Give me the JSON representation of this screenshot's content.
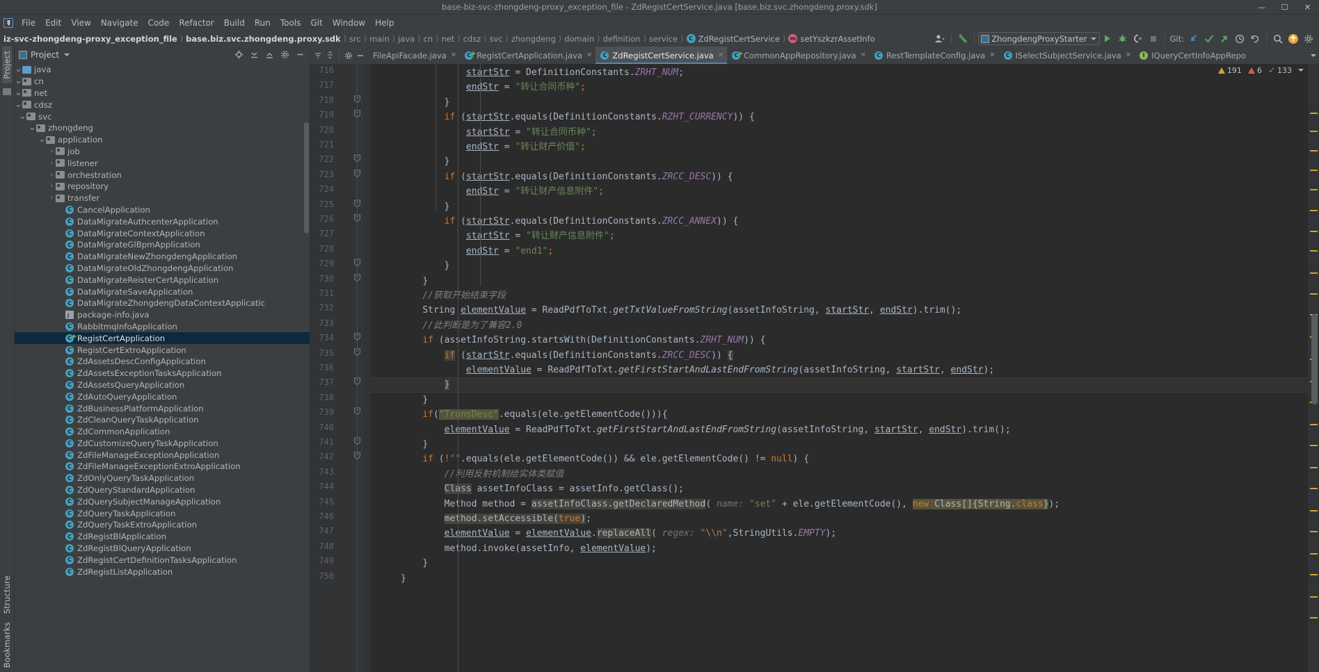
{
  "window": {
    "title": "base-biz-svc-zhongdeng-proxy_exception_file - ZdRegistCertService.java [base.biz.svc.zhongdeng.proxy.sdk]",
    "minimize": "—",
    "maximize": "☐",
    "close": "✕"
  },
  "menubar": {
    "logo": "IJ",
    "items": [
      "File",
      "Edit",
      "View",
      "Navigate",
      "Code",
      "Refactor",
      "Build",
      "Run",
      "Tools",
      "Git",
      "Window",
      "Help"
    ]
  },
  "breadcrumbs": {
    "project": "iz-svc-zhongdeng-proxy_exception_file",
    "module": "base.biz.svc.zhongdeng.proxy.sdk",
    "path": [
      "src",
      "main",
      "java",
      "cn",
      "net",
      "cdsz",
      "svc",
      "zhongdeng",
      "domain",
      "definition",
      "service"
    ],
    "class": "ZdRegistCertService",
    "class_icon": "C",
    "method": "setYszkzrAssetInfo",
    "method_icon": "m"
  },
  "toolbar": {
    "profile_icon": "person-icon",
    "back_icon": "back-arrow-icon",
    "run_config": "ZhongdengProxyStarter",
    "run_icon": "run-icon",
    "debug_icon": "debug-icon",
    "coverage_icon": "run-coverage-icon",
    "stop_icon": "stop-icon",
    "git_label": "Git:",
    "update_icon": "update-project-icon",
    "commit_icon": "commit-icon",
    "push_icon": "push-icon",
    "history_icon": "history-icon",
    "rollback_icon": "rollback-icon",
    "search_icon": "search-everywhere-icon",
    "notification_icon": "notification-icon",
    "settings_icon": "settings-icon"
  },
  "left_strip": {
    "project_label": "Project",
    "structure_label": "Structure",
    "bookmarks_label": "Bookmarks"
  },
  "project_panel": {
    "title": "Project",
    "locate_icon": "locate-file-icon",
    "expand_icon": "expand-all-icon",
    "collapse_icon": "collapse-all-icon",
    "settings_icon": "gear-icon",
    "hide_icon": "hide-panel-icon",
    "tree": [
      {
        "label": "java",
        "indent": 5,
        "arrow": "v",
        "icon": "folder-blue"
      },
      {
        "label": "cn",
        "indent": 6,
        "arrow": "v",
        "icon": "folder-pkg"
      },
      {
        "label": "net",
        "indent": 7,
        "arrow": "v",
        "icon": "folder-pkg"
      },
      {
        "label": "cdsz",
        "indent": 8,
        "arrow": "v",
        "icon": "folder-pkg"
      },
      {
        "label": "svc",
        "indent": 9,
        "arrow": "v",
        "icon": "folder-pkg"
      },
      {
        "label": "zhongdeng",
        "indent": 10,
        "arrow": "v",
        "icon": "folder-pkg"
      },
      {
        "label": "application",
        "indent": 11,
        "arrow": "v",
        "icon": "folder-pkg"
      },
      {
        "label": "job",
        "indent": 12,
        "arrow": ">",
        "icon": "folder-pkg"
      },
      {
        "label": "listener",
        "indent": 12,
        "arrow": ">",
        "icon": "folder-pkg"
      },
      {
        "label": "orchestration",
        "indent": 12,
        "arrow": ">",
        "icon": "folder-pkg"
      },
      {
        "label": "repository",
        "indent": 12,
        "arrow": ">",
        "icon": "folder-pkg"
      },
      {
        "label": "transfer",
        "indent": 12,
        "arrow": ">",
        "icon": "folder-pkg"
      },
      {
        "label": "CancelApplication",
        "indent": 13,
        "arrow": "",
        "icon": "class"
      },
      {
        "label": "DataMigrateAuthcenterApplication",
        "indent": 13,
        "arrow": "",
        "icon": "class"
      },
      {
        "label": "DataMigrateContextApplication",
        "indent": 13,
        "arrow": "",
        "icon": "class"
      },
      {
        "label": "DataMigrateGlBpmApplication",
        "indent": 13,
        "arrow": "",
        "icon": "class"
      },
      {
        "label": "DataMigrateNewZhongdengApplication",
        "indent": 13,
        "arrow": "",
        "icon": "class"
      },
      {
        "label": "DataMigrateOldZhongdengApplication",
        "indent": 13,
        "arrow": "",
        "icon": "class"
      },
      {
        "label": "DataMigrateReisterCertApplication",
        "indent": 13,
        "arrow": "",
        "icon": "class"
      },
      {
        "label": "DataMigrateSaveApplication",
        "indent": 13,
        "arrow": "",
        "icon": "class"
      },
      {
        "label": "DataMigrateZhongdengDataContextApplicatic",
        "indent": 13,
        "arrow": "",
        "icon": "class"
      },
      {
        "label": "package-info.java",
        "indent": 13,
        "arrow": "",
        "icon": "package-info"
      },
      {
        "label": "RabbitmqInfoApplication",
        "indent": 13,
        "arrow": "",
        "icon": "class"
      },
      {
        "label": "RegistCertApplication",
        "indent": 13,
        "arrow": "",
        "icon": "class-run",
        "selected": true
      },
      {
        "label": "RegistCertExtroApplication",
        "indent": 13,
        "arrow": "",
        "icon": "class"
      },
      {
        "label": "ZdAssetsDescConfigApplication",
        "indent": 13,
        "arrow": "",
        "icon": "class"
      },
      {
        "label": "ZdAssetsExceptionTasksApplication",
        "indent": 13,
        "arrow": "",
        "icon": "class"
      },
      {
        "label": "ZdAssetsQueryApplication",
        "indent": 13,
        "arrow": "",
        "icon": "class"
      },
      {
        "label": "ZdAutoQueryApplication",
        "indent": 13,
        "arrow": "",
        "icon": "class"
      },
      {
        "label": "ZdBusinessPlatformApplication",
        "indent": 13,
        "arrow": "",
        "icon": "class"
      },
      {
        "label": "ZdCleanQueryTaskApplication",
        "indent": 13,
        "arrow": "",
        "icon": "class"
      },
      {
        "label": "ZdCommonApplication",
        "indent": 13,
        "arrow": "",
        "icon": "class"
      },
      {
        "label": "ZdCustomizeQueryTaskApplication",
        "indent": 13,
        "arrow": "",
        "icon": "class"
      },
      {
        "label": "ZdFileManageExceptionApplication",
        "indent": 13,
        "arrow": "",
        "icon": "class"
      },
      {
        "label": "ZdFileManageExceptionExtroApplication",
        "indent": 13,
        "arrow": "",
        "icon": "class"
      },
      {
        "label": "ZdOnlyQueryTaskApplication",
        "indent": 13,
        "arrow": "",
        "icon": "class"
      },
      {
        "label": "ZdQueryStandardApplication",
        "indent": 13,
        "arrow": "",
        "icon": "class"
      },
      {
        "label": "ZdQuerySubjectManageApplication",
        "indent": 13,
        "arrow": "",
        "icon": "class"
      },
      {
        "label": "ZdQueryTaskApplication",
        "indent": 13,
        "arrow": "",
        "icon": "class"
      },
      {
        "label": "ZdQueryTaskExtroApplication",
        "indent": 13,
        "arrow": "",
        "icon": "class"
      },
      {
        "label": "ZdRegistBlApplication",
        "indent": 13,
        "arrow": "",
        "icon": "class"
      },
      {
        "label": "ZdRegistBlQueryApplication",
        "indent": 13,
        "arrow": "",
        "icon": "class"
      },
      {
        "label": "ZdRegistCertDefinitionTasksApplication",
        "indent": 13,
        "arrow": "",
        "icon": "class"
      },
      {
        "label": "ZdRegistListApplication",
        "indent": 13,
        "arrow": "",
        "icon": "class"
      }
    ]
  },
  "editor_tabs": [
    {
      "label": "FileApiFacade.java",
      "icon": "none",
      "active": false,
      "close": "✕"
    },
    {
      "label": "RegistCertApplication.java",
      "icon": "class-run",
      "active": false,
      "close": "✕"
    },
    {
      "label": "ZdRegistCertService.java",
      "icon": "class",
      "active": true,
      "close": "✕"
    },
    {
      "label": "CommonAppRepository.java",
      "icon": "class-run",
      "active": false,
      "close": "✕"
    },
    {
      "label": "RestTemplateConfig.java",
      "icon": "class",
      "active": false,
      "close": "✕"
    },
    {
      "label": "ISelectSubjectService.java",
      "icon": "class",
      "active": false,
      "close": "✕"
    },
    {
      "label": "IQueryCertInfoAppRepo",
      "icon": "interface",
      "active": false,
      "close": ""
    }
  ],
  "inspection": {
    "warnings": "191",
    "warnings_icon": "warning-triangle-icon",
    "weak_warnings": "6",
    "weak_warnings_icon": "weak-warning-icon",
    "ok_count": "133",
    "ok_icon": "checkmark-icon",
    "chevron_icon": "chevron-down-icon"
  },
  "code": {
    "first_line": 716,
    "current_line": 737,
    "lines": [
      {
        "n": 716,
        "fold": "",
        "html": "            <span class='loc'>startStr</span> <span class='pln'>=</span> <span class='cls2'>DefinitionConstants</span><span class='pln'>.</span><span class='fld'>ZRHT_NUM</span><span class='pln'>;</span>"
      },
      {
        "n": 717,
        "fold": "",
        "html": "            <span class='loc'>endStr</span> <span class='pln'>=</span> <span class='str'>\"转让合同币种\"</span><span class='kw'>;</span>"
      },
      {
        "n": 718,
        "fold": "-",
        "html": "        <span class='pln'>}</span>"
      },
      {
        "n": 719,
        "fold": "-",
        "html": "        <span class='kw'>if</span> <span class='pln'>(</span><span class='loc'>startStr</span><span class='pln'>.equals(</span><span class='cls2'>DefinitionConstants</span><span class='pln'>.</span><span class='fld'>RZHT_CURRENCY</span><span class='pln'>)) {</span>"
      },
      {
        "n": 720,
        "fold": "",
        "html": "            <span class='loc'>startStr</span> <span class='pln'>=</span> <span class='str'>\"转让合同币种\"</span><span class='kw'>;</span>"
      },
      {
        "n": 721,
        "fold": "",
        "html": "            <span class='loc'>endStr</span> <span class='pln'>=</span> <span class='str'>\"转让财产价值\"</span><span class='kw'>;</span>"
      },
      {
        "n": 722,
        "fold": "-",
        "html": "        <span class='pln'>}</span>"
      },
      {
        "n": 723,
        "fold": "-",
        "html": "        <span class='kw'>if</span> <span class='pln'>(</span><span class='loc'>startStr</span><span class='pln'>.equals(</span><span class='cls2'>DefinitionConstants</span><span class='pln'>.</span><span class='fld'>ZRCC_DESC</span><span class='pln'>)) {</span>"
      },
      {
        "n": 724,
        "fold": "",
        "html": "            <span class='loc'>endStr</span> <span class='pln'>=</span> <span class='str'>\"转让财产信息附件\"</span><span class='kw'>;</span>"
      },
      {
        "n": 725,
        "fold": "-",
        "html": "        <span class='pln'>}</span>"
      },
      {
        "n": 726,
        "fold": "-",
        "html": "        <span class='kw'>if</span> <span class='pln'>(</span><span class='loc'>startStr</span><span class='pln'>.equals(</span><span class='cls2'>DefinitionConstants</span><span class='pln'>.</span><span class='fld'>ZRCC_ANNEX</span><span class='pln'>)) {</span>"
      },
      {
        "n": 727,
        "fold": "",
        "html": "            <span class='loc'>startStr</span> <span class='pln'>=</span> <span class='str'>\"转让财产信息附件\"</span><span class='kw'>;</span>"
      },
      {
        "n": 728,
        "fold": "",
        "html": "            <span class='loc'>endStr</span> <span class='pln'>=</span> <span class='str'>\"end1\"</span><span class='kw'>;</span>"
      },
      {
        "n": 729,
        "fold": "-",
        "html": "        <span class='pln'>}</span>"
      },
      {
        "n": 730,
        "fold": "-",
        "html": "    <span class='pln'>}</span>"
      },
      {
        "n": 731,
        "fold": "",
        "html": "    <span class='cmt'>//获取开始结束字段</span>"
      },
      {
        "n": 732,
        "fold": "",
        "html": "    <span class='cls2'>String</span> <span class='loc'>elementValue</span> <span class='pln'>=</span> <span class='cls2'>ReadPdfToTxt</span><span class='pln'>.</span><span class='mtd'>getTxtValueFromString</span><span class='pln'>(</span><span class='pln'>assetInfoString</span><span class='pln'>, </span><span class='loc'>startStr</span><span class='pln'>, </span><span class='loc'>endStr</span><span class='pln'>).trim();</span>"
      },
      {
        "n": 733,
        "fold": "",
        "html": "    <span class='cmt'>//此判断是为了兼容2.0</span>"
      },
      {
        "n": 734,
        "fold": "-",
        "html": "    <span class='kw'>if</span> <span class='pln'>(</span><span class='pln'>assetInfoString</span><span class='pln'>.startsWith(</span><span class='cls2'>DefinitionConstants</span><span class='pln'>.</span><span class='fld'>ZRHT_NUM</span><span class='pln'>)) {</span>"
      },
      {
        "n": 735,
        "fold": "-",
        "html": "        <span class='kw hl'>if</span> <span class='pln'>(</span><span class='loc'>startStr</span><span class='pln'>.equals(</span><span class='cls2'>DefinitionConstants</span><span class='pln'>.</span><span class='fld'>ZRCC_DESC</span><span class='pln'>)) <span class='hl'>{</span></span>"
      },
      {
        "n": 736,
        "fold": "",
        "html": "            <span class='loc'>elementValue</span> <span class='pln'>=</span> <span class='cls2'>ReadPdfToTxt</span><span class='pln'>.</span><span class='mtd'>getFirstStartAndLastEndFromString</span><span class='pln'>(</span><span class='pln'>assetInfoString</span><span class='pln'>, </span><span class='loc'>startStr</span><span class='pln'>, </span><span class='loc'>endStr</span><span class='pln'>);</span>"
      },
      {
        "n": 737,
        "fold": "-",
        "html": "        <span class='pln hl'>}</span>"
      },
      {
        "n": 738,
        "fold": "",
        "html": "    <span class='pln'>}</span>"
      },
      {
        "n": 739,
        "fold": "-",
        "html": "    <span class='kw'>if</span><span class='pln'>(</span><span class='str hl2'>\"TransDesc\"</span><span class='pln'>.equals(ele.getElementCode())){</span>"
      },
      {
        "n": 740,
        "fold": "",
        "html": "        <span class='loc'>elementValue</span> <span class='pln'>=</span> <span class='cls2'>ReadPdfToTxt</span><span class='pln'>.</span><span class='mtd'>getFirstStartAndLastEndFromString</span><span class='pln'>(</span><span class='pln'>assetInfoString</span><span class='pln'>, </span><span class='loc'>startStr</span><span class='pln'>, </span><span class='loc'>endStr</span><span class='pln'>).trim();</span>"
      },
      {
        "n": 741,
        "fold": "-",
        "html": "    <span class='pln'>}</span>"
      },
      {
        "n": 742,
        "fold": "-",
        "html": "    <span class='kw'>if</span> <span class='pln'>(</span><span class='kw'>!</span><span class='str'>\"\"</span><span class='pln'>.equals(ele.getElementCode()) &amp;&amp; ele.getElementCode() != </span><span class='kw'>null</span><span class='pln'>) {</span>"
      },
      {
        "n": 743,
        "fold": "",
        "html": "        <span class='cmt'>//利用反射机制给实体类赋值</span>"
      },
      {
        "n": 744,
        "fold": "",
        "html": "        <span class='cls2 hl'>Class</span> <span class='pln'>assetInfoClass = assetInfo.getClass();</span>"
      },
      {
        "n": 745,
        "fold": "",
        "html": "        <span class='cls2'>Method</span> <span class='pln'>method = </span><span class='pln hl'>assetInfoClass.getDeclaredMethod</span><span class='pln'>(</span> <span class='hint'>name:</span> <span class='str'>\"set\"</span><span class='pln'> + ele.getElementCode(), </span><span class='kw hl2'>new</span><span class='hl2'> </span><span class='cls2 hl2'>Class</span><span class='pln hl2'>[]{</span><span class='cls2 hl2'>String</span><span class='pln hl2'>.</span><span class='kw hl2'>class</span><span class='pln hl2'>}</span><span class='pln'>);</span>"
      },
      {
        "n": 746,
        "fold": "",
        "html": "        <span class='pln hl'>method.setAccessible(</span><span class='kw hl'>true</span><span class='pln hl'>)</span><span class='pln'>;</span>"
      },
      {
        "n": 747,
        "fold": "",
        "html": "        <span class='loc'>elementValue</span> <span class='pln'>= </span><span class='loc'>elementValue</span><span class='pln'>.</span><span class='pln hl'>replaceAll</span><span class='pln'>(</span> <span class='hint'>regex:</span> <span class='str'>\"</span><span class='kw'>\\\\n</span><span class='str'>\"</span><span class='pln'>,</span><span class='cls2'>StringUtils</span><span class='pln'>.</span><span class='fld'>EMPTY</span><span class='pln'>);</span>"
      },
      {
        "n": 748,
        "fold": "",
        "html": "        <span class='pln'>method.invoke(assetInfo, </span><span class='loc'>elementValue</span><span class='pln'>);</span>"
      },
      {
        "n": 749,
        "fold": "",
        "html": "    <span class='pln'>}</span>"
      },
      {
        "n": 750,
        "fold": "",
        "html": "<span class='pln'>}</span>"
      }
    ]
  }
}
